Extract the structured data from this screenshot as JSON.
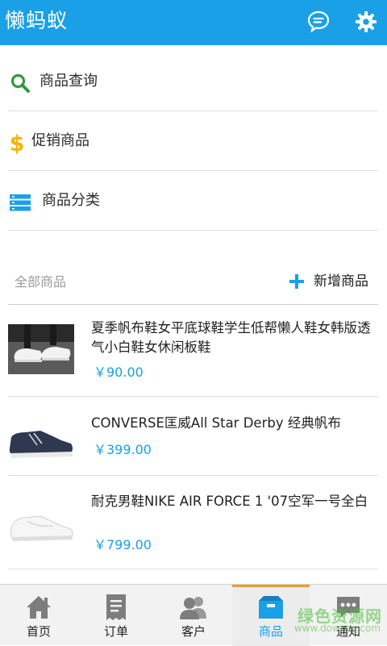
{
  "header": {
    "title": "懒蚂蚁",
    "message_icon": "chat-bubble-icon",
    "settings_icon": "gear-icon"
  },
  "menu": [
    {
      "label": "商品查询",
      "icon": "search-icon",
      "color": "#2e9b3a"
    },
    {
      "label": "促销商品",
      "icon": "dollar-icon",
      "color": "#f5b400"
    },
    {
      "label": "商品分类",
      "icon": "list-icon",
      "color": "#1aa0e6"
    }
  ],
  "section": {
    "all_label": "全部商品",
    "add_label": "新增商品"
  },
  "products": [
    {
      "name": "夏季帆布鞋女平底球鞋学生低帮懒人鞋女韩版透气小白鞋女休闲板鞋",
      "price": "￥90.00"
    },
    {
      "name": "CONVERSE匡威All Star Derby 经典帆布",
      "price": "￥399.00"
    },
    {
      "name": "耐克男鞋NIKE AIR FORCE 1 '07空军一号全白",
      "price": "￥799.00"
    }
  ],
  "tabs": [
    {
      "label": "首页",
      "icon": "home-icon"
    },
    {
      "label": "订单",
      "icon": "order-icon"
    },
    {
      "label": "客户",
      "icon": "customers-icon"
    },
    {
      "label": "商品",
      "icon": "box-icon",
      "active": true
    },
    {
      "label": "通知",
      "icon": "chat-dots-icon"
    }
  ],
  "watermark": {
    "text": "绿色资源网",
    "url": "www.downcc.com"
  },
  "colors": {
    "primary": "#1aa0e6",
    "active_tab_accent": "#f39c26"
  }
}
